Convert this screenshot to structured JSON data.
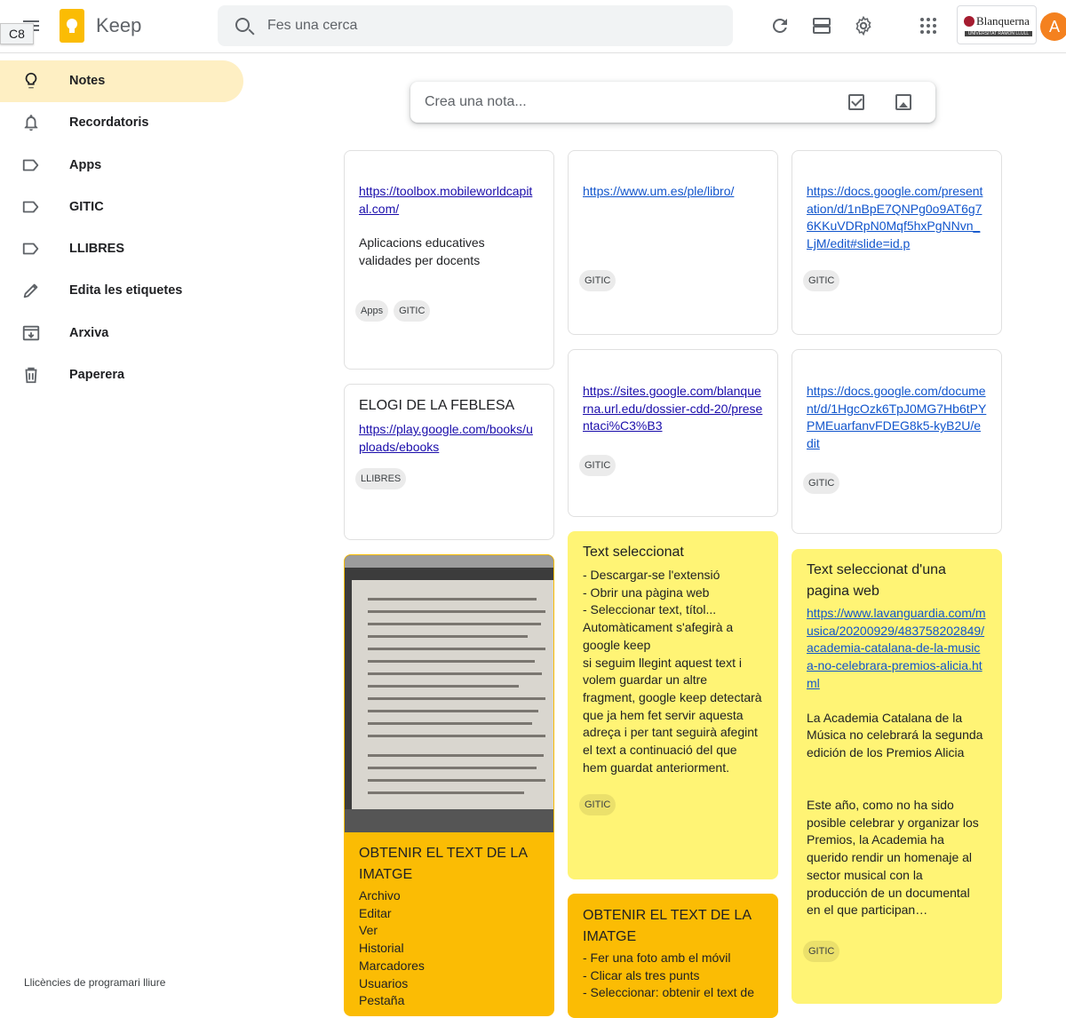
{
  "tooltip": "C8",
  "app": {
    "name": "Keep"
  },
  "search": {
    "placeholder": "Fes una cerca"
  },
  "org": {
    "name": "Blanquerna",
    "sub": "UNIVERSITAT RAMON LLULL"
  },
  "avatar": {
    "initial": "A",
    "color": "#f4811f"
  },
  "sidebar": {
    "items": [
      {
        "label": "Notes",
        "icon": "lightbulb-icon",
        "active": true
      },
      {
        "label": "Recordatoris",
        "icon": "bell-icon"
      },
      {
        "label": "Apps",
        "icon": "label-icon"
      },
      {
        "label": "GITIC",
        "icon": "label-icon"
      },
      {
        "label": "LLIBRES",
        "icon": "label-icon"
      },
      {
        "label": "Edita les etiquetes",
        "icon": "pencil-icon"
      },
      {
        "label": "Arxiva",
        "icon": "archive-icon"
      },
      {
        "label": "Paperera",
        "icon": "trash-icon"
      }
    ],
    "license": "Llicències de programari lliure"
  },
  "take_note": {
    "placeholder": "Crea una nota..."
  },
  "notes": {
    "n1": {
      "link": "https://toolbox.mobileworldcapital.com/",
      "text": "Aplicacions educatives validades per docents",
      "labels": [
        "Apps",
        "GITIC"
      ]
    },
    "n2": {
      "title": "ELOGI DE LA FEBLESA",
      "link": "https://play.google.com/books/uploads/ebooks",
      "labels": [
        "LLIBRES"
      ]
    },
    "n3": {
      "title": "OBTENIR EL TEXT DE LA IMATGE",
      "text": "Archivo\nEditar\nVer\nHistorial\nMarcadores\nUsuarios\nPestaña"
    },
    "n4": {
      "link": "https://www.um.es/ple/libro/",
      "labels": [
        "GITIC"
      ]
    },
    "n5": {
      "link": "https://sites.google.com/blanquerna.url.edu/dossier-cdd-20/presentaci%C3%B3",
      "labels": [
        "GITIC"
      ]
    },
    "n6": {
      "title": "Text seleccionat",
      "text": "- Descargar-se l'extensió\n- Obrir una pàgina web\n- Seleccionar text, títol...\nAutomàticament s'afegirà a google keep\nsi seguim llegint aquest text i volem guardar un altre fragment, google keep detectarà que ja hem fet servir aquesta adreça i per tant seguirà afegint el text a continuació del que hem guardat anteriorment.",
      "labels": [
        "GITIC"
      ]
    },
    "n7": {
      "title": "OBTENIR EL TEXT DE LA IMATGE",
      "text": "- Fer una foto amb el móvil\n- Clicar als tres punts\n- Seleccionar: obtenir el text de"
    },
    "n8": {
      "link": "https://docs.google.com/presentation/d/1nBpE7QNPg0o9AT6g76KKuVDRpN0Mqf5hxPgNNvn_LjM/edit#slide=id.p",
      "labels": [
        "GITIC"
      ]
    },
    "n9": {
      "link": "https://docs.google.com/document/d/1HgcOzk6TpJ0MG7Hb6tPYPMEuarfanvFDEG8k5-kyB2U/edit",
      "labels": [
        "GITIC"
      ]
    },
    "n10": {
      "title": "Text seleccionat d'una pagina web",
      "link": "https://www.lavanguardia.com/musica/20200929/483758202849/academia-catalana-de-la-musica-no-celebrara-premios-alicia.html",
      "text": "La Academia Catalana de la Música no celebrará la segunda edición de los Premios Alicia\n\n\nEste año, como no ha sido posible celebrar y organizar los Premios, la Academia ha querido rendir un homenaje al sector musical con la producción de un documental en el que participan…",
      "labels": [
        "GITIC"
      ]
    }
  },
  "colors": {
    "yellow": "#fff475",
    "orange": "#fbbc04",
    "active_nav": "#feefc3"
  }
}
